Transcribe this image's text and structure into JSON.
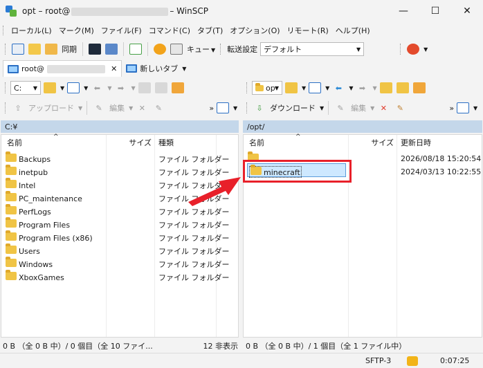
{
  "window": {
    "title_prefix": "opt – root@",
    "title_suffix": "– WinSCP",
    "controls": {
      "minimize": "—",
      "maximize": "☐",
      "close": "✕"
    }
  },
  "menu": [
    "ローカル(L)",
    "マーク(M)",
    "ファイル(F)",
    "コマンド(C)",
    "タブ(T)",
    "オプション(O)",
    "リモート(R)",
    "ヘルプ(H)"
  ],
  "toolbar": {
    "sync_label": "同期",
    "queue_label": "キュー",
    "transfer_settings_label": "転送設定",
    "transfer_preset": "デフォルト"
  },
  "tabs": {
    "session_prefix": "root@",
    "new_tab_label": "新しいタブ"
  },
  "left": {
    "drive": "C:",
    "upload_label": "アップロード",
    "edit_label": "編集",
    "path": "C:¥",
    "columns": {
      "name": "名前",
      "size": "サイズ",
      "type": "種類"
    },
    "rows": [
      {
        "name": "Backups",
        "type": "ファイル フォルダー"
      },
      {
        "name": "inetpub",
        "type": "ファイル フォルダー"
      },
      {
        "name": "Intel",
        "type": "ファイル フォルダー"
      },
      {
        "name": "PC_maintenance",
        "type": "ファイル フォルダー"
      },
      {
        "name": "PerfLogs",
        "type": "ファイル フォルダー"
      },
      {
        "name": "Program Files",
        "type": "ファイル フォルダー"
      },
      {
        "name": "Program Files (x86)",
        "type": "ファイル フォルダー"
      },
      {
        "name": "Users",
        "type": "ファイル フォルダー"
      },
      {
        "name": "Windows",
        "type": "ファイル フォルダー"
      },
      {
        "name": "XboxGames",
        "type": "ファイル フォルダー"
      }
    ],
    "status": "0 B （全 0 B 中）/ 0 個目（全 10 ファイ...",
    "hidden_count": "12 非表示"
  },
  "right": {
    "drive": "op",
    "download_label": "ダウンロード",
    "edit_label": "編集",
    "path": "/opt/",
    "columns": {
      "name": "名前",
      "size": "サイズ",
      "modified": "更新日時"
    },
    "parent_modified": "2026/08/18 15:20:54",
    "rows": [
      {
        "name": "minecraft",
        "modified": "2024/03/13 10:22:55"
      }
    ],
    "status": "0 B （全 0 B 中）/ 1 個目（全 1 ファイル中）"
  },
  "bottom": {
    "protocol": "SFTP-3",
    "elapsed": "0:07:25"
  },
  "colors": {
    "path_bar": "#c4d7ea",
    "selection": "#cde8ff",
    "highlight_box": "#e8202a",
    "folder": "#f0c445"
  }
}
